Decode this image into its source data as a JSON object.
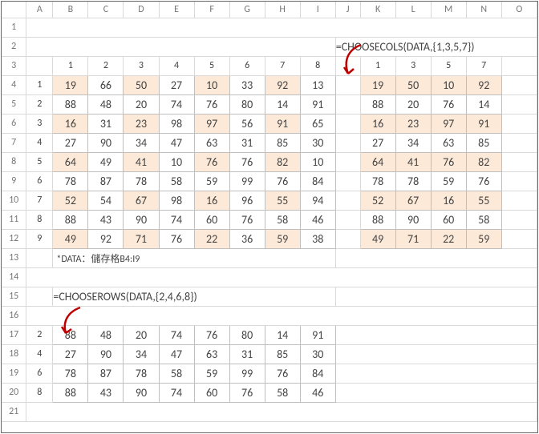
{
  "columns": [
    "",
    "A",
    "B",
    "C",
    "D",
    "E",
    "F",
    "G",
    "H",
    "I",
    "J",
    "K",
    "L",
    "M",
    "N",
    "O"
  ],
  "rows": [
    "1",
    "2",
    "3",
    "4",
    "5",
    "6",
    "7",
    "8",
    "9",
    "10",
    "11",
    "12",
    "13",
    "14",
    "15",
    "16",
    "17",
    "18",
    "19",
    "20",
    "21"
  ],
  "main": {
    "col_hdrs": [
      "1",
      "2",
      "3",
      "4",
      "5",
      "6",
      "7",
      "8"
    ],
    "row_hdrs": [
      "1",
      "2",
      "3",
      "4",
      "5",
      "6",
      "7",
      "8",
      "9"
    ],
    "data": [
      [
        "19",
        "66",
        "50",
        "27",
        "10",
        "33",
        "92",
        "13"
      ],
      [
        "88",
        "48",
        "20",
        "74",
        "76",
        "80",
        "14",
        "91"
      ],
      [
        "16",
        "31",
        "23",
        "98",
        "97",
        "56",
        "91",
        "65"
      ],
      [
        "27",
        "90",
        "34",
        "47",
        "63",
        "31",
        "85",
        "30"
      ],
      [
        "64",
        "49",
        "41",
        "10",
        "76",
        "76",
        "82",
        "10"
      ],
      [
        "78",
        "87",
        "78",
        "58",
        "59",
        "99",
        "76",
        "84"
      ],
      [
        "52",
        "54",
        "67",
        "98",
        "16",
        "96",
        "55",
        "94"
      ],
      [
        "88",
        "43",
        "90",
        "74",
        "60",
        "76",
        "58",
        "46"
      ],
      [
        "49",
        "92",
        "71",
        "76",
        "22",
        "36",
        "59",
        "38"
      ]
    ]
  },
  "note": "*DATA：儲存格B4:I9",
  "formula_cols": "=CHOOSECOLS(DATA,{1,3,5,7})",
  "formula_rows": "=CHOOSEROWS(DATA,{2,4,6,8})",
  "cols_result": {
    "hdrs": [
      "1",
      "3",
      "5",
      "7"
    ],
    "data": [
      [
        "19",
        "50",
        "10",
        "92"
      ],
      [
        "88",
        "20",
        "76",
        "14"
      ],
      [
        "16",
        "23",
        "97",
        "91"
      ],
      [
        "27",
        "34",
        "63",
        "85"
      ],
      [
        "64",
        "41",
        "76",
        "82"
      ],
      [
        "78",
        "78",
        "59",
        "76"
      ],
      [
        "52",
        "67",
        "16",
        "55"
      ],
      [
        "88",
        "90",
        "60",
        "58"
      ],
      [
        "49",
        "71",
        "22",
        "59"
      ]
    ]
  },
  "rows_result": {
    "hdrs": [
      "2",
      "4",
      "6",
      "8"
    ],
    "data": [
      [
        "88",
        "48",
        "20",
        "74",
        "76",
        "80",
        "14",
        "91"
      ],
      [
        "27",
        "90",
        "34",
        "47",
        "63",
        "31",
        "85",
        "30"
      ],
      [
        "78",
        "87",
        "78",
        "58",
        "59",
        "99",
        "76",
        "84"
      ],
      [
        "88",
        "43",
        "90",
        "74",
        "60",
        "76",
        "58",
        "46"
      ]
    ]
  },
  "chart_data": {
    "type": "table",
    "title": "Excel CHOOSECOLS / CHOOSEROWS demo",
    "source_range": "B4:I9",
    "source": [
      [
        19,
        66,
        50,
        27,
        10,
        33,
        92,
        13
      ],
      [
        88,
        48,
        20,
        74,
        76,
        80,
        14,
        91
      ],
      [
        16,
        31,
        23,
        98,
        97,
        56,
        91,
        65
      ],
      [
        27,
        90,
        34,
        47,
        63,
        31,
        85,
        30
      ],
      [
        64,
        49,
        41,
        10,
        76,
        76,
        82,
        10
      ],
      [
        78,
        87,
        78,
        58,
        59,
        99,
        76,
        84
      ],
      [
        52,
        54,
        67,
        98,
        16,
        96,
        55,
        94
      ],
      [
        88,
        43,
        90,
        74,
        60,
        76,
        58,
        46
      ],
      [
        49,
        92,
        71,
        76,
        22,
        36,
        59,
        38
      ]
    ],
    "choosecols": {
      "formula": "=CHOOSECOLS(DATA,{1,3,5,7})",
      "cols": [
        1,
        3,
        5,
        7
      ]
    },
    "chooserows": {
      "formula": "=CHOOSEROWS(DATA,{2,4,6,8})",
      "rows": [
        2,
        4,
        6,
        8
      ]
    }
  }
}
